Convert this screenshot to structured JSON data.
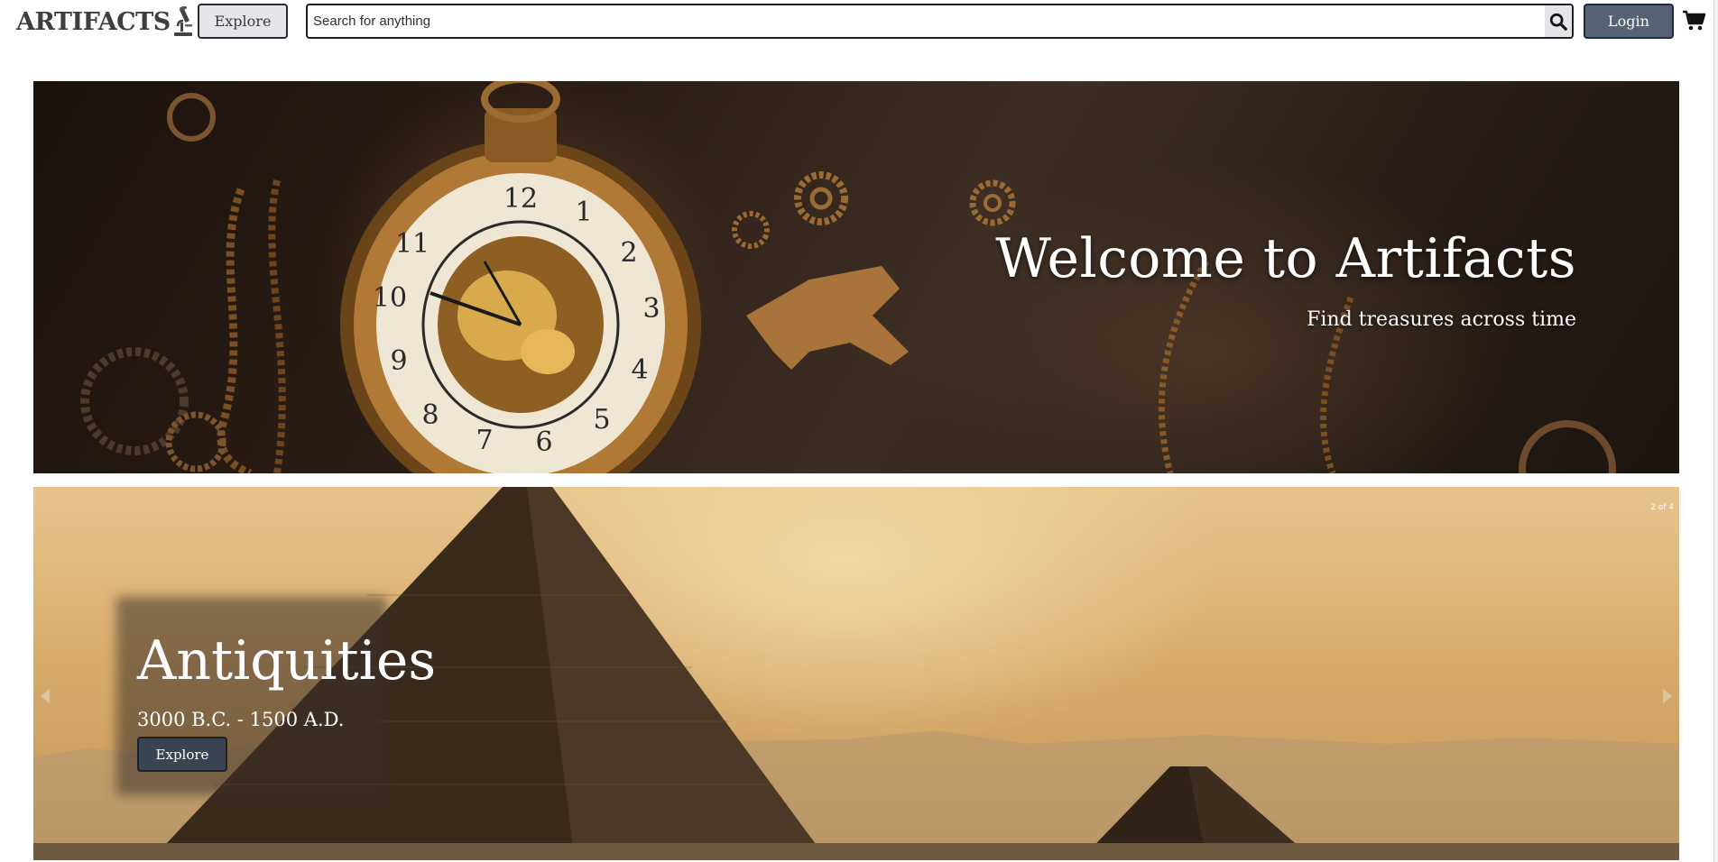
{
  "header": {
    "logo_text": "ARTIFACTS",
    "explore_label": "Explore",
    "search_placeholder": "Search for anything",
    "search_value": "",
    "login_label": "Login"
  },
  "hero": {
    "title": "Welcome to Artifacts",
    "subtitle": "Find treasures across time"
  },
  "carousel": {
    "counter": "2 of 4",
    "slide_title": "Antiquities",
    "slide_period": "3000 B.C. - 1500 A.D.",
    "slide_button": "Explore"
  },
  "icons": {
    "logo": "microscope-icon",
    "search": "search-icon",
    "cart": "cart-icon",
    "prev": "chevron-left-icon",
    "next": "chevron-right-icon"
  },
  "colors": {
    "login_bg": "#556174",
    "explore_bg": "#e4e6ea",
    "slide_button_bg": "#3b4452"
  }
}
